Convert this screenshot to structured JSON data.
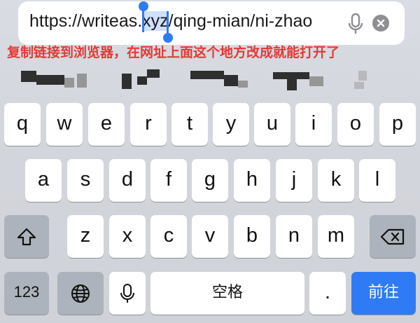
{
  "url_bar": {
    "before_selection": "https://writeas.",
    "selection": "xyz",
    "after_selection": "/qing-mian/ni-zhao"
  },
  "annotation": "复制链接到浏览器，在网址上面这个地方改成就能打开了",
  "keyboard": {
    "row1": [
      "q",
      "w",
      "e",
      "r",
      "t",
      "y",
      "u",
      "i",
      "o",
      "p"
    ],
    "row2": [
      "a",
      "s",
      "d",
      "f",
      "g",
      "h",
      "j",
      "k",
      "l"
    ],
    "row3": [
      "z",
      "x",
      "c",
      "v",
      "b",
      "n",
      "m"
    ],
    "numbers_label": "123",
    "space_label": "空格",
    "period_label": ".",
    "go_label": "前往"
  },
  "colors": {
    "accent": "#2f7bf5",
    "annotation": "#e53935"
  },
  "icons": [
    "microphone-icon",
    "clear-icon",
    "shift-icon",
    "backspace-icon",
    "globe-icon"
  ]
}
